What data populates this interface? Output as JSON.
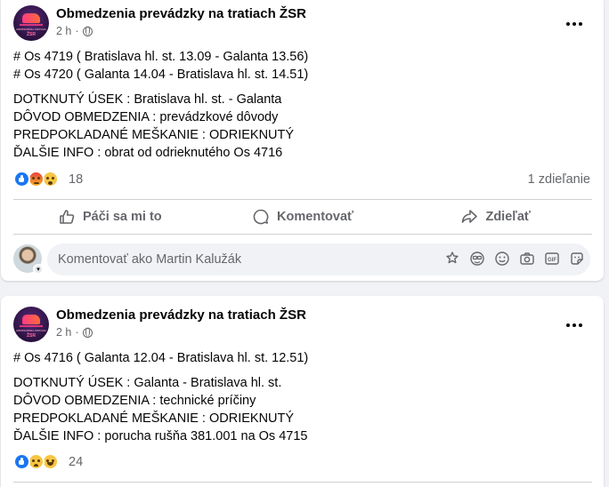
{
  "colors": {
    "background": "#f0f2f5",
    "card": "#ffffff",
    "text": "#050505",
    "muted": "#65676b",
    "accent": "#1877f2"
  },
  "posts": [
    {
      "page_name": "Obmedzenia prevádzky na tratiach ŽSR",
      "avatar_caption": "OBMEDZENIA PREVÁDZKY",
      "avatar_logo": "ŽSR",
      "time": "2 h",
      "dot": "·",
      "audience_icon": "globe-icon",
      "body_lines": [
        "# Os 4719 ( Bratislava hl. st. 13.09 - Galanta 13.56)",
        "# Os 4720 ( Galanta 14.04 - Bratislava hl. st. 14.51)",
        "",
        "DOTKNUTÝ ÚSEK : Bratislava hl. st. - Galanta",
        "DÔVOD OBMEDZENIA : prevádzkové dôvody",
        "PREDPOKLADANÉ MEŠKANIE : ODRIEKNUTÝ",
        "ĎALŠIE INFO : obrat od odrieknutého Os 4716"
      ],
      "reactions": [
        "like",
        "angry",
        "wow"
      ],
      "reaction_count": "18",
      "shares": "1 zdieľanie"
    },
    {
      "page_name": "Obmedzenia prevádzky na tratiach ŽSR",
      "avatar_caption": "OBMEDZENIA PREVÁDZKY",
      "avatar_logo": "ŽSR",
      "time": "2 h",
      "dot": "·",
      "audience_icon": "globe-icon",
      "body_lines": [
        "# Os 4716 ( Galanta 12.04 - Bratislava hl. st. 12.51)",
        "",
        "DOTKNUTÝ ÚSEK : Galanta - Bratislava hl. st.",
        "DÔVOD OBMEDZENIA : technické príčiny",
        "PREDPOKLADANÉ MEŠKANIE : ODRIEKNUTÝ",
        "ĎALŠIE INFO : porucha rušňa 381.001 na Os 4715"
      ],
      "reactions": [
        "like",
        "sad",
        "haha"
      ],
      "reaction_count": "24"
    }
  ],
  "actions": {
    "like": "Páči sa mi to",
    "comment": "Komentovať",
    "share": "Zdieľať"
  },
  "comment": {
    "placeholder": "Komentovať ako Martin Kalužák",
    "icons": [
      "avatar-sticker-icon",
      "emoji-face-icon",
      "smile-icon",
      "camera-icon",
      "gif-icon",
      "sticker-icon"
    ]
  }
}
